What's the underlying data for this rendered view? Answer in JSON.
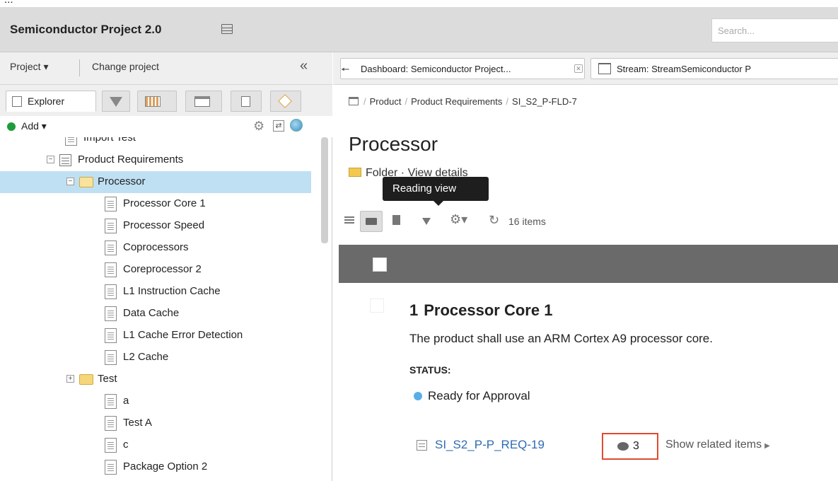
{
  "app": {
    "title": "Semiconductor Project 2.0",
    "search_placeholder": "Search..."
  },
  "left_panel": {
    "project_menu": "Project",
    "change_project": "Change project",
    "explorer_tab": "Explorer",
    "add_label": "Add",
    "tree": [
      {
        "label": "Import Test",
        "indent": 0,
        "icon": "doc-icon"
      },
      {
        "label": "Product Requirements",
        "indent": 1,
        "icon": "list-icon",
        "expander": "−"
      },
      {
        "label": "Processor",
        "indent": 2,
        "icon": "folder-open-icon",
        "expander": "−",
        "selected": true
      },
      {
        "label": "Processor Core 1",
        "indent": 3,
        "icon": "doc-icon"
      },
      {
        "label": "Processor Speed",
        "indent": 3,
        "icon": "doc-icon"
      },
      {
        "label": "Coprocessors",
        "indent": 3,
        "icon": "doc-icon"
      },
      {
        "label": "Coreprocessor 2",
        "indent": 3,
        "icon": "doc-icon"
      },
      {
        "label": "L1 Instruction Cache",
        "indent": 3,
        "icon": "doc-icon"
      },
      {
        "label": "Data Cache",
        "indent": 3,
        "icon": "doc-icon"
      },
      {
        "label": "L1 Cache Error Detection",
        "indent": 3,
        "icon": "doc-icon"
      },
      {
        "label": "L2 Cache",
        "indent": 3,
        "icon": "doc-icon"
      },
      {
        "label": "Test",
        "indent": 2,
        "icon": "folder-icon",
        "expander": "+"
      },
      {
        "label": "a",
        "indent": 3,
        "icon": "doc-icon"
      },
      {
        "label": "Test A",
        "indent": 3,
        "icon": "doc-icon"
      },
      {
        "label": "c",
        "indent": 3,
        "icon": "doc-icon"
      },
      {
        "label": "Package Option 2",
        "indent": 3,
        "icon": "doc-icon"
      }
    ]
  },
  "right_panel": {
    "tabs": [
      {
        "label": "Dashboard: Semiconductor Project..."
      },
      {
        "label": "Stream: StreamSemiconductor P"
      }
    ],
    "breadcrumb": [
      "Product",
      "Product Requirements",
      "SI_S2_P-FLD-7"
    ],
    "page_title": "Processor",
    "folder_line": "Folder · View details",
    "tooltip": "Reading view",
    "items_count": "16 items",
    "item": {
      "number": "1",
      "title": "Processor Core 1",
      "description": "The product shall use an ARM Cortex A9 processor core.",
      "status_label": "STATUS:",
      "status_value": "Ready for Approval",
      "status_color": "#5aaee8",
      "id": "SI_S2_P-P_REQ-19",
      "comment_count": "3",
      "show_related": "Show related items"
    }
  }
}
